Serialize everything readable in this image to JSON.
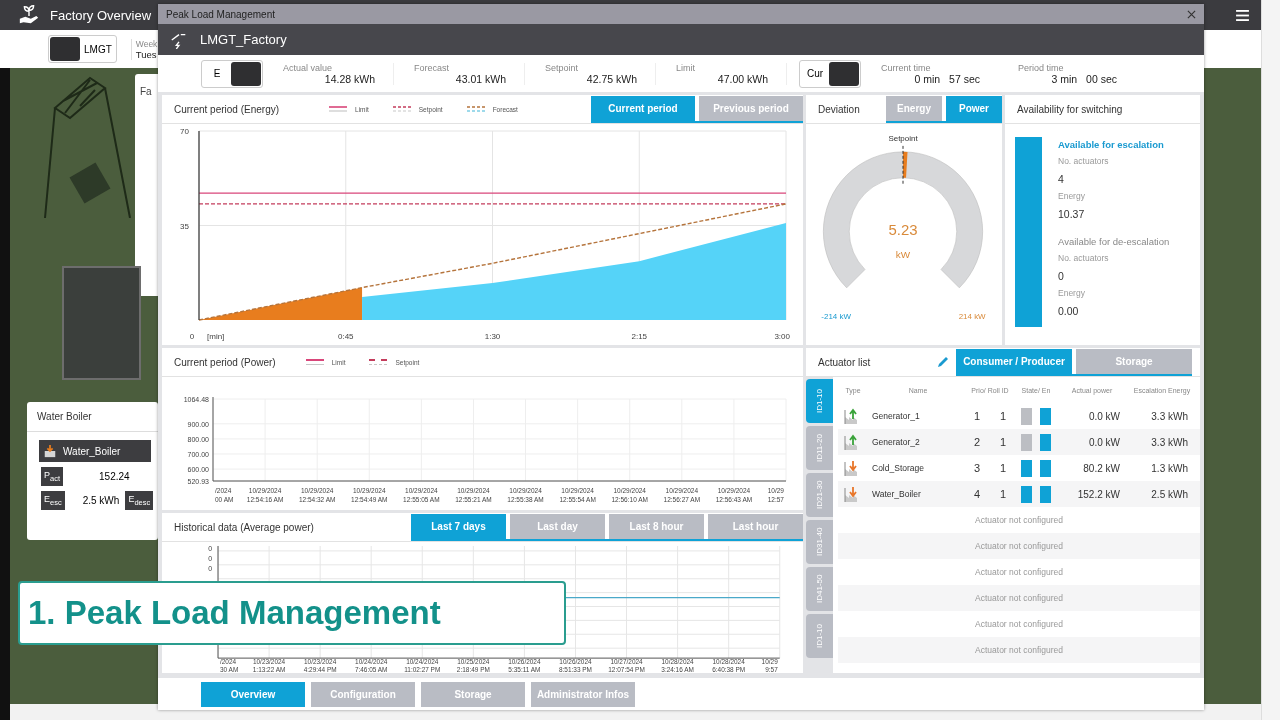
{
  "app": {
    "title": "Factory Overview",
    "toolbar": {
      "toggle_label": "LMGT",
      "week_label": "Week",
      "day_value": "Tues"
    },
    "behind_tab": "Fa",
    "boiler_card": {
      "title": "Water Boiler",
      "device": "Water_Boiler",
      "p_label": "P$_{act}$",
      "p_value": "152.24",
      "e_esc_label": "E$_{esc}$",
      "e_esc_value": "2.5 kWh",
      "e_desc_label": "E$_{desc}$"
    }
  },
  "window": {
    "title": "Peak Load Management",
    "header": "LMGT_Factory"
  },
  "summary": {
    "mode_toggle": "E",
    "fields": [
      {
        "label": "Actual value",
        "value": "14.28 kWh"
      },
      {
        "label": "Forecast",
        "value": "43.01 kWh"
      },
      {
        "label": "Setpoint",
        "value": "42.75 kWh"
      },
      {
        "label": "Limit",
        "value": "47.00 kWh"
      }
    ],
    "time_toggle": "Cur",
    "times": [
      {
        "label": "Current time",
        "minutes": "0 min",
        "seconds": "57 sec"
      },
      {
        "label": "Period time",
        "minutes": "3 min",
        "seconds": "00 sec"
      }
    ]
  },
  "energy": {
    "tabs": [
      {
        "label": "Current period",
        "selected": true
      },
      {
        "label": "Previous period",
        "selected": false
      }
    ],
    "chart_data": {
      "type": "line",
      "grid": true,
      "title": "Current period (Energy)",
      "xlabel": "[min]",
      "x": [
        0,
        50,
        90,
        135,
        180
      ],
      "xlim": [
        0,
        180
      ],
      "ylim": [
        0,
        70
      ],
      "xticks": [
        {
          "value": 0,
          "label": "0"
        },
        {
          "value": 45,
          "label": "0:45"
        },
        {
          "value": 90,
          "label": "1:30"
        },
        {
          "value": 135,
          "label": "2:15"
        },
        {
          "value": 180,
          "label": "3:00"
        }
      ],
      "yticks": [
        35,
        70
      ],
      "series": [
        {
          "name": "Limit",
          "color": "#d9467a",
          "type": "line",
          "line_style": "solid",
          "values": [
            47,
            47,
            47,
            47,
            47
          ]
        },
        {
          "name": "Setpoint",
          "color": "#c43c5c",
          "type": "line",
          "line_style": "dashed",
          "values": [
            43,
            43,
            43,
            43,
            43
          ]
        },
        {
          "name": "Forecast",
          "color": "#b5743c",
          "type": "line",
          "line_style": "dashed",
          "values": [
            0,
            12,
            21,
            32,
            43
          ]
        },
        {
          "color": "#e87d1e",
          "type": "area",
          "values": [
            0,
            12,
            null,
            null,
            null
          ]
        },
        {
          "color": "#55d3f8",
          "type": "area",
          "values": [
            null,
            8.5,
            13.7,
            21.8,
            35.9
          ]
        }
      ]
    }
  },
  "deviation": {
    "title": "Deviation",
    "tabs": [
      {
        "label": "Energy",
        "selected": false
      },
      {
        "label": "Power",
        "selected": true
      }
    ],
    "setpoint_label": "Setpoint",
    "value": "5.23",
    "unit": "kW",
    "level": 0.512,
    "min_label": "-214 kW",
    "max_label": "214 kW"
  },
  "availability": {
    "title": "Availability for switching",
    "level": 1,
    "groups": [
      {
        "title": "Available for escalation",
        "active": true,
        "count_label": "No. actuators",
        "count": "4",
        "energy_label": "Energy",
        "energy": "10.37"
      },
      {
        "title": "Available for de-escalation",
        "active": false,
        "count_label": "No. actuators",
        "count": "0",
        "energy_label": "Energy",
        "energy": "0.00"
      }
    ]
  },
  "power": {
    "chart_data": {
      "type": "line",
      "grid": true,
      "title": "Current period (Power)",
      "ylim": [
        520.93,
        1064.48
      ],
      "yticks": [
        {
          "value": 520.93,
          "label": "520.93"
        },
        {
          "value": 600,
          "label": "600.00"
        },
        {
          "value": 700,
          "label": "700.00"
        },
        {
          "value": 800,
          "label": "800.00"
        },
        {
          "value": 900,
          "label": "900.00"
        },
        {
          "value": 1064.48,
          "label": "1064.48"
        }
      ],
      "categories": [
        "/2024\n00 AM",
        "10/29/2024\n12:54:16 AM",
        "10/29/2024\n12:54:32 AM",
        "10/29/2024\n12:54:49 AM",
        "10/29/2024\n12:55:05 AM",
        "10/29/2024\n12:55:21 AM",
        "10/29/2024\n12:55:38 AM",
        "10/29/2024\n12:55:54 AM",
        "10/29/2024\n12:56:10 AM",
        "10/29/2024\n12:56:27 AM",
        "10/29/2024\n12:56:43 AM",
        "10/29\n12:57"
      ]
    },
    "legend": [
      {
        "label": "Limit",
        "color": "#d9467a"
      },
      {
        "label": "Setpoint",
        "color": "#c43c5c"
      }
    ]
  },
  "historical": {
    "title": "Historical data (Average power)",
    "tabs": [
      {
        "label": "Last 7 days",
        "selected": true
      },
      {
        "label": "Last day",
        "selected": false
      },
      {
        "label": "Last 8 hour",
        "selected": false
      },
      {
        "label": "Last hour",
        "selected": false
      }
    ],
    "y_labels": [
      "0",
      "0",
      "0"
    ],
    "x_labels": [
      "/2024\n30 AM",
      "10/23/2024\n1:13:22 AM",
      "10/23/2024\n4:29:44 PM",
      "10/24/2024\n7:46:05 AM",
      "10/24/2024\n11:02:27 PM",
      "10/25/2024\n2:18:49 PM",
      "10/26/2024\n5:35:11 AM",
      "10/26/2024\n8:51:33 PM",
      "10/27/2024\n12:07:54 PM",
      "10/28/2024\n3:24:16 AM",
      "10/28/2024\n6:40:38 PM",
      "10/29\n9:57"
    ]
  },
  "actuators": {
    "title": "Actuator list",
    "tabs": [
      {
        "label": "Consumer / Producer",
        "selected": true
      },
      {
        "label": "Storage",
        "selected": false
      }
    ],
    "ranges": [
      {
        "label": "ID1-10",
        "selected": true
      },
      {
        "label": "ID11-20",
        "selected": false
      },
      {
        "label": "ID21-30",
        "selected": false
      },
      {
        "label": "ID31-40",
        "selected": false
      },
      {
        "label": "ID41-50",
        "selected": false
      },
      {
        "label": "ID1-10",
        "selected": false
      }
    ],
    "columns": [
      "Type",
      "Name",
      "Prio/ Roll ID",
      "State/ En",
      "Actual power",
      "Escalation Energy"
    ],
    "rows": [
      {
        "kind": "producer",
        "name": "Generator_1",
        "prio": "1",
        "roll_id": "1",
        "state": false,
        "enabled": true,
        "power": "0.0 kW",
        "energy": "3.3 kWh"
      },
      {
        "kind": "producer",
        "name": "Generator_2",
        "prio": "2",
        "roll_id": "1",
        "state": false,
        "enabled": true,
        "power": "0.0 kW",
        "energy": "3.3 kWh"
      },
      {
        "kind": "consumer",
        "name": "Cold_Storage",
        "prio": "3",
        "roll_id": "1",
        "state": true,
        "enabled": true,
        "power": "80.2 kW",
        "energy": "1.3 kWh"
      },
      {
        "kind": "consumer",
        "name": "Water_Boiler",
        "prio": "4",
        "roll_id": "1",
        "state": true,
        "enabled": true,
        "power": "152.2 kW",
        "energy": "2.5 kWh"
      },
      {
        "kind": "empty",
        "note": "Actuator not configured"
      },
      {
        "kind": "empty",
        "note": "Actuator not configured"
      },
      {
        "kind": "empty",
        "note": "Actuator not configured"
      },
      {
        "kind": "empty",
        "note": "Actuator not configured"
      },
      {
        "kind": "empty",
        "note": "Actuator not configured"
      },
      {
        "kind": "empty",
        "note": "Actuator not configured"
      }
    ]
  },
  "nav": [
    {
      "label": "Overview",
      "selected": true
    },
    {
      "label": "Configuration",
      "selected": false
    },
    {
      "label": "Storage",
      "selected": false
    },
    {
      "label": "Administrator Infos",
      "selected": false
    }
  ],
  "caption": "1. Peak Load Management"
}
